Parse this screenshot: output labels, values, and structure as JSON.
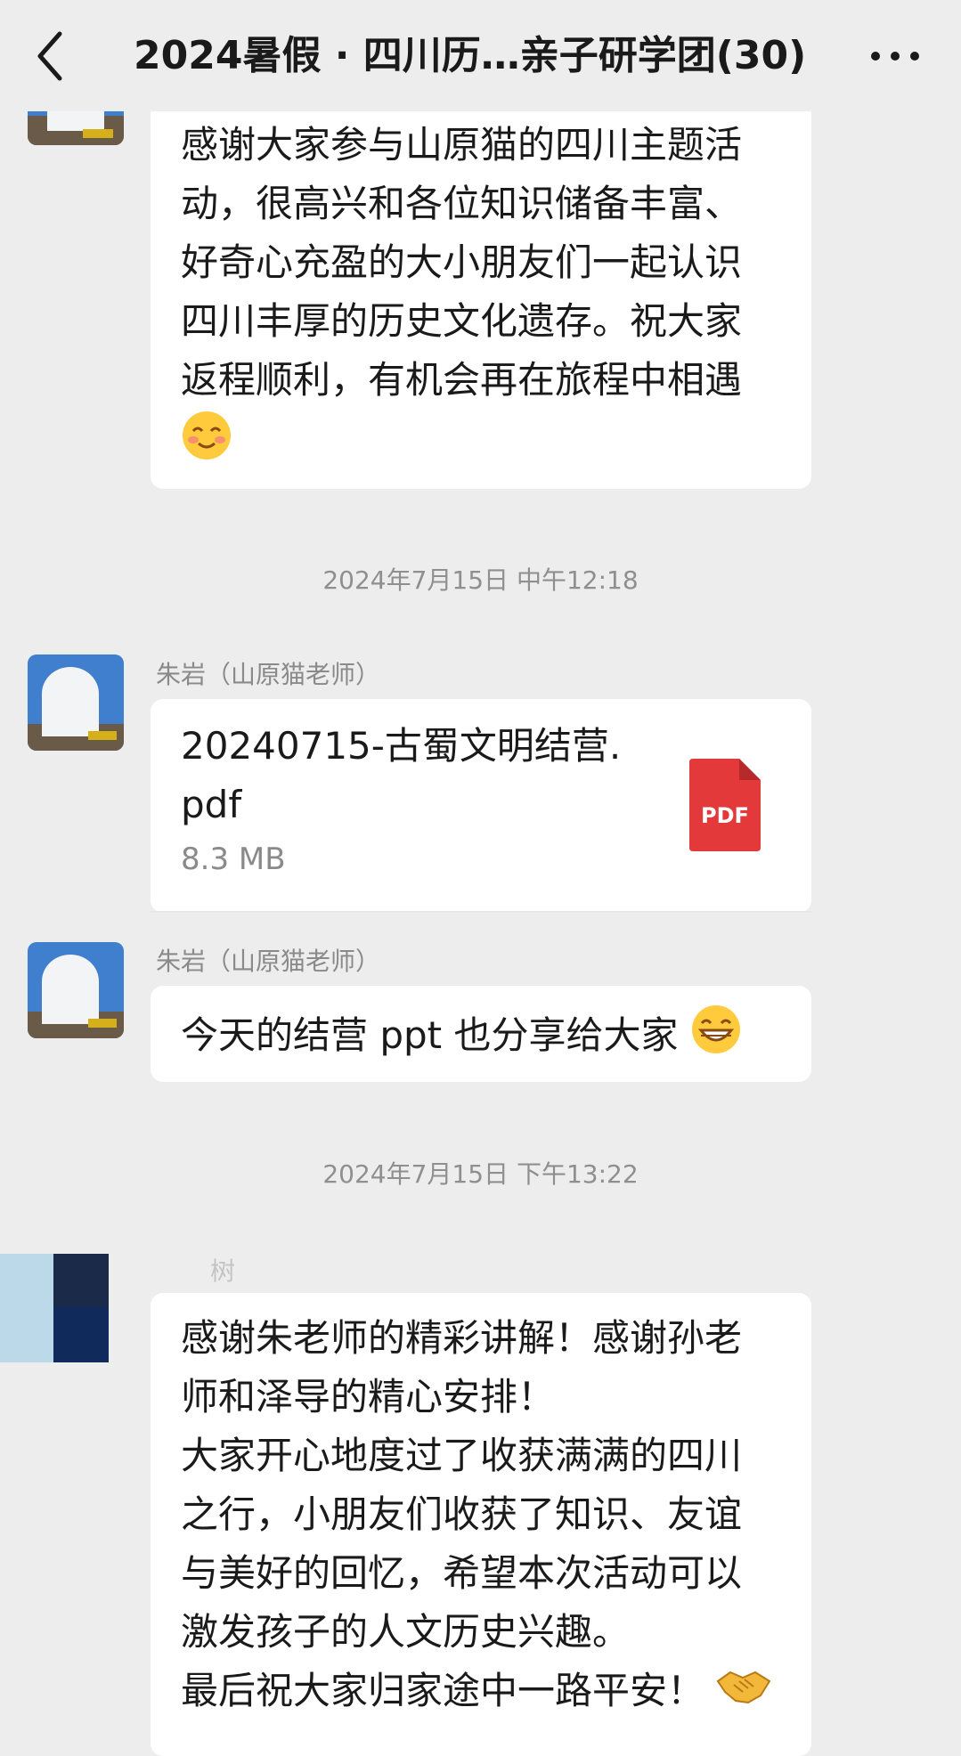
{
  "header": {
    "title": "2024暑假 · 四川历…亲子研学团(30)"
  },
  "messages": {
    "m1": {
      "lines": [
        "感谢大家参与山原猫的四川主题活",
        "动，很高兴和各位知识储备丰富、",
        "好奇心充盈的大小朋友们一起认识",
        "四川丰厚的历史文化遗存。祝大家",
        "返程顺利，有机会再在旅程中相遇"
      ]
    },
    "time1": "2024年7月15日 中午12:18",
    "m2": {
      "sender": "朱岩（山原猫老师）",
      "file_name_line1": "20240715-古蜀文明结营.",
      "file_name_line2": "pdf",
      "file_size": "8.3 MB",
      "file_badge": "PDF"
    },
    "m3": {
      "sender": "朱岩（山原猫老师）",
      "text": "今天的结营 ppt 也分享给大家"
    },
    "time2": "2024年7月15日 下午13:22",
    "m4": {
      "sender": "树",
      "lines": [
        "感谢朱老师的精彩讲解！感谢孙老",
        "师和泽导的精心安排！",
        "大家开心地度过了收获满满的四川",
        "之行，小朋友们收获了知识、友谊",
        "与美好的回忆，希望本次活动可以",
        "激发孩子的人文历史兴趣。",
        "最后祝大家归家途中一路平安！"
      ]
    }
  },
  "colors": {
    "background": "#ededed",
    "bubble": "#ffffff",
    "pdf_red": "#e3393a"
  }
}
